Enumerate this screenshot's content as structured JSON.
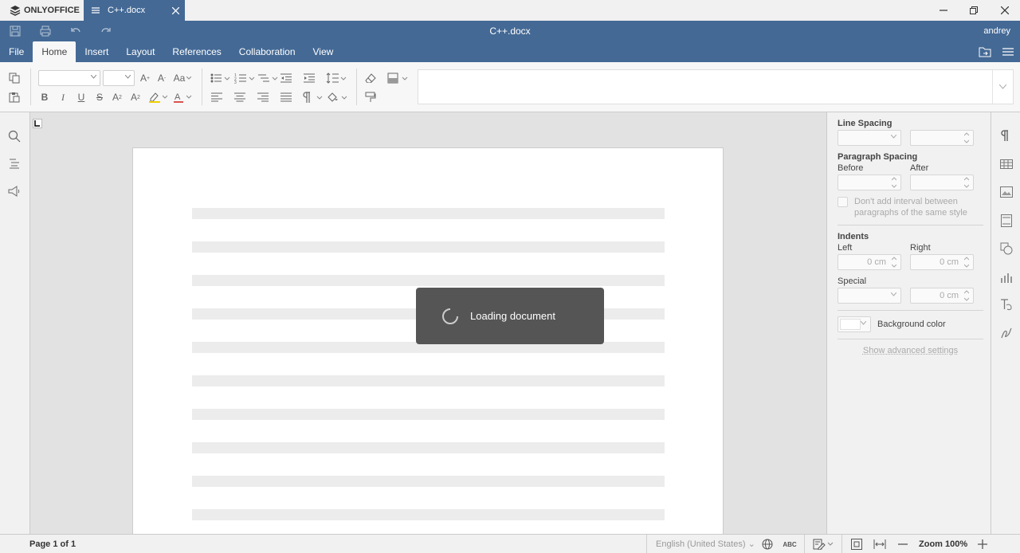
{
  "app": {
    "brand": "ONLYOFFICE",
    "tab_title": "C++.docx"
  },
  "header": {
    "title": "C++.docx",
    "user": "andrey"
  },
  "menu": {
    "tabs": [
      "File",
      "Home",
      "Insert",
      "Layout",
      "References",
      "Collaboration",
      "View"
    ],
    "active": "Home"
  },
  "loader": {
    "text": "Loading document"
  },
  "right_panel": {
    "line_spacing": "Line Spacing",
    "paragraph_spacing": "Paragraph Spacing",
    "before": "Before",
    "after": "After",
    "dont_add_1": "Don't add interval between",
    "dont_add_2": "paragraphs of the same style",
    "indents": "Indents",
    "left": "Left",
    "right": "Right",
    "left_value": "0 cm",
    "right_value": "0 cm",
    "special": "Special",
    "special_value": "0 cm",
    "background_color": "Background color",
    "advanced": "Show advanced settings"
  },
  "status": {
    "page": "Page 1 of 1",
    "language": "English (United States)",
    "zoom": "Zoom 100%"
  },
  "colors": {
    "accent": "#446995",
    "highlight": "#f0d000",
    "font_color": "#d9534f"
  }
}
